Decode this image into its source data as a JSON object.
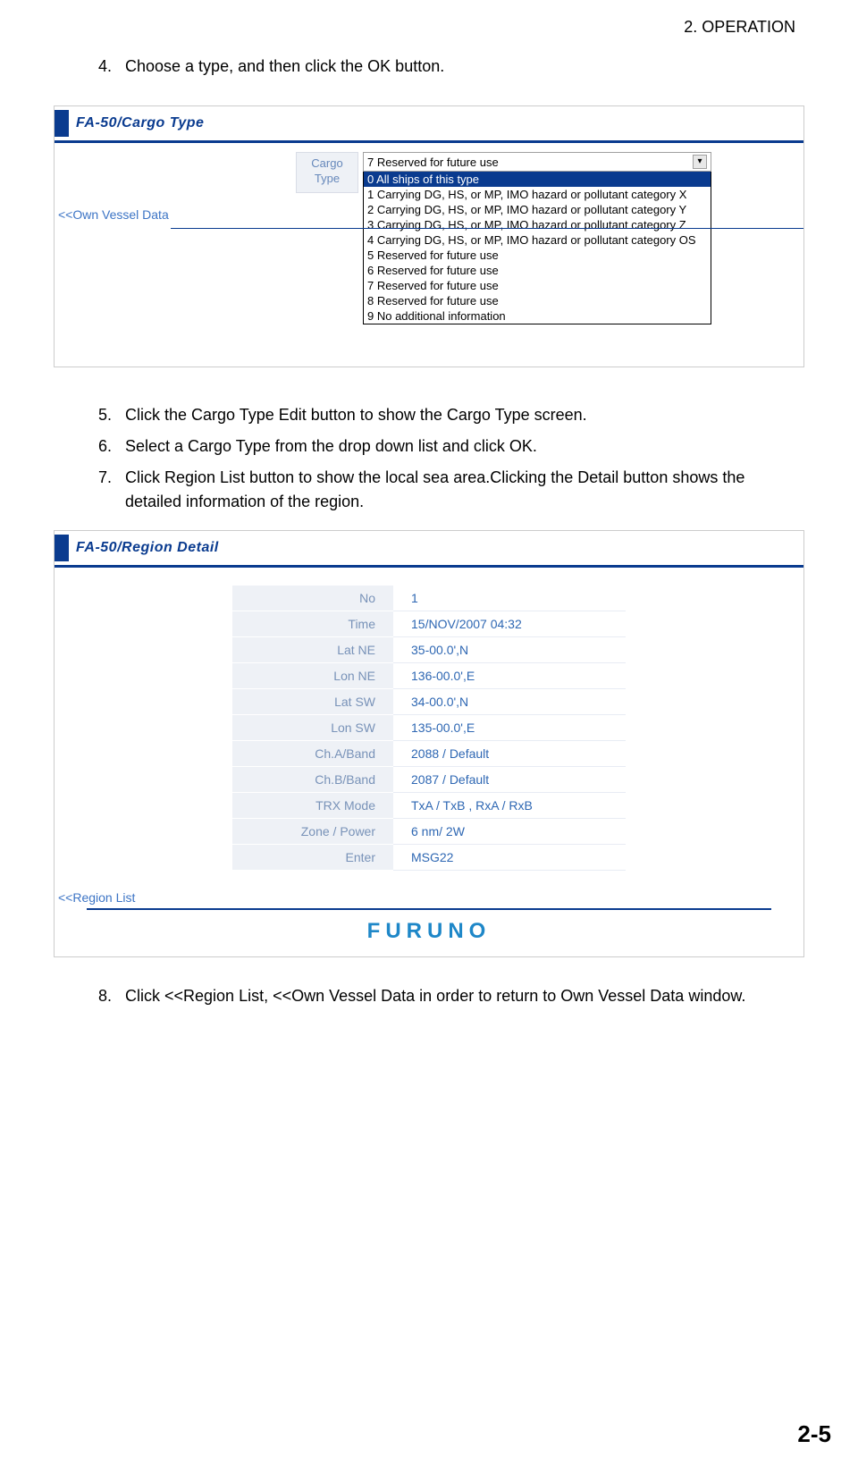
{
  "header": {
    "chapter": "2.  OPERATION"
  },
  "steps": {
    "s4": {
      "n": "4.",
      "t": "Choose a type, and then click the OK button."
    },
    "s5": {
      "n": "5.",
      "t": "Click the Cargo Type Edit button to show the Cargo Type screen."
    },
    "s6": {
      "n": "6.",
      "t": "Select a Cargo Type from the drop down list and click OK."
    },
    "s7": {
      "n": "7.",
      "t": "Click Region List button to show the local sea area.Clicking the Detail button shows the detailed information of the region."
    },
    "s8": {
      "n": "8.",
      "t": "Click <<Region List, <<Own Vessel Data in order to return to Own Vessel Data window."
    }
  },
  "fig1": {
    "title": "FA-50/Cargo Type",
    "label_l1": "Cargo",
    "label_l2": "Type",
    "selected": "7 Reserved for future use",
    "options": [
      "0 All ships of this type",
      "1 Carrying DG, HS, or MP, IMO hazard or pollutant category X",
      "2 Carrying DG, HS, or MP, IMO hazard or pollutant category Y",
      "3 Carrying DG, HS, or MP, IMO hazard or pollutant category Z",
      "4 Carrying DG, HS, or MP, IMO hazard or pollutant category OS",
      "5 Reserved for future use",
      "6 Reserved for future use",
      "7 Reserved for future use",
      "8 Reserved for future use",
      "9 No additional information"
    ],
    "backlink": "<<Own Vessel Data"
  },
  "fig2": {
    "title": "FA-50/Region Detail",
    "rows": [
      {
        "l": "No",
        "v": "1"
      },
      {
        "l": "Time",
        "v": "15/NOV/2007 04:32"
      },
      {
        "l": "Lat NE",
        "v": "35-00.0',N"
      },
      {
        "l": "Lon NE",
        "v": "136-00.0',E"
      },
      {
        "l": "Lat SW",
        "v": "34-00.0',N"
      },
      {
        "l": "Lon SW",
        "v": "135-00.0',E"
      },
      {
        "l": "Ch.A/Band",
        "v": "2088 / Default"
      },
      {
        "l": "Ch.B/Band",
        "v": "2087 / Default"
      },
      {
        "l": "TRX Mode",
        "v": "TxA / TxB , RxA / RxB"
      },
      {
        "l": "Zone / Power",
        "v": "6 nm/ 2W"
      },
      {
        "l": "Enter",
        "v": "MSG22"
      }
    ],
    "backlink": "<<Region List",
    "brand": "FURUNO"
  },
  "pagenum": "2-5"
}
